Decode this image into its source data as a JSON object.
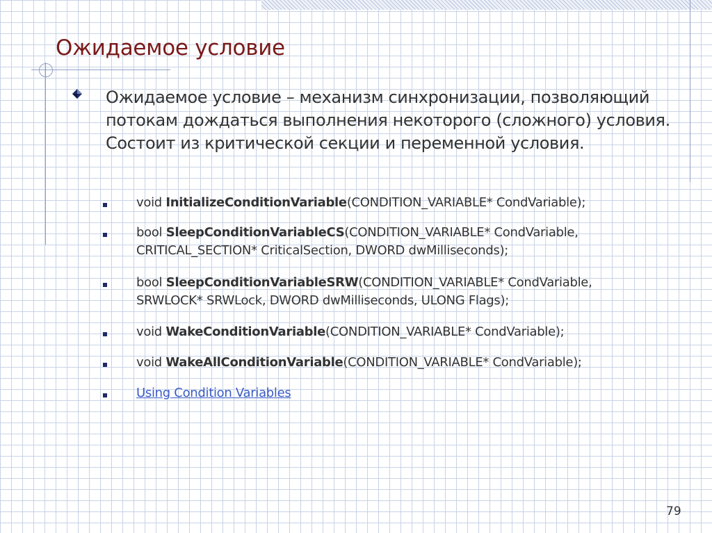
{
  "slide": {
    "title": "Ожидаемое условие",
    "main_bullet": "Ожидаемое условие – механизм синхронизации, позволяющий потокам дождаться выполнения некоторого (сложного) условия. Состоит из критической секции и переменной условия.",
    "items": [
      {
        "pre": "void ",
        "name": "InitializeConditionVariable",
        "post": "(CONDITION_VARIABLE* CondVariable);",
        "post2": ""
      },
      {
        "pre": "bool ",
        "name": "SleepConditionVariableCS",
        "post": "(CONDITION_VARIABLE* CondVariable,",
        "post2": "CRITICAL_SECTION* CriticalSection, DWORD dwMilliseconds);"
      },
      {
        "pre": "bool ",
        "name": "SleepConditionVariableSRW",
        "post": "(CONDITION_VARIABLE* CondVariable,",
        "post2": "SRWLOCK* SRWLock, DWORD dwMilliseconds, ULONG Flags);"
      },
      {
        "pre": "void ",
        "name": "WakeConditionVariable",
        "post": "(CONDITION_VARIABLE* CondVariable);",
        "post2": ""
      },
      {
        "pre": "void ",
        "name": "WakeAllConditionVariable",
        "post": "(CONDITION_VARIABLE* CondVariable);",
        "post2": ""
      }
    ],
    "link_text": "Using Condition Variables",
    "page_number": "79"
  },
  "icons": {
    "main_bullet": "diamond-bullet-icon",
    "sub_bullet": "square-bullet-icon"
  },
  "colors": {
    "title": "#7a1a1a",
    "text": "#333333",
    "link": "#3a5bc4",
    "grid": "#c9d3e6",
    "accent_line": "#8fa0c8",
    "bullet": "#1f2b66"
  }
}
